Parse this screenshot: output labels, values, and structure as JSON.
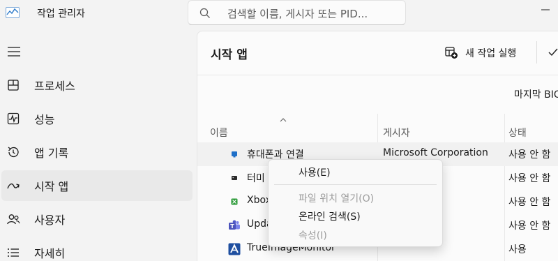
{
  "app": {
    "title": "작업 관리자"
  },
  "search": {
    "placeholder": "검색할 이름, 게시자 또는 PID..."
  },
  "sidebar": {
    "items": [
      {
        "label": "프로세스",
        "icon": "processes-icon"
      },
      {
        "label": "성능",
        "icon": "performance-icon"
      },
      {
        "label": "앱 기록",
        "icon": "app-history-icon"
      },
      {
        "label": "시작 앱",
        "icon": "startup-apps-icon",
        "active": true
      },
      {
        "label": "사용자",
        "icon": "users-icon"
      },
      {
        "label": "자세히",
        "icon": "details-icon"
      }
    ]
  },
  "main": {
    "title": "시작 앱",
    "new_task_label": "새 작업 실행",
    "last_bios_label": "마지막 BIO",
    "columns": {
      "name": "이름",
      "publisher": "게시자",
      "status": "상태"
    },
    "rows": [
      {
        "name": "휴대폰과 연결",
        "publisher": "Microsoft Corporation",
        "status": "사용 안 함",
        "icon": "phone-link-icon"
      },
      {
        "name": "터미",
        "publisher": "rporation",
        "status": "사용 안 함",
        "icon": "terminal-icon"
      },
      {
        "name": "Xbox",
        "publisher": "rporation",
        "status": "사용 안 함",
        "icon": "xbox-icon"
      },
      {
        "name": "Upda",
        "publisher": "",
        "status": "사용 안 함",
        "icon": "teams-icon"
      },
      {
        "name": "TrueImageMonitor",
        "publisher": "",
        "status": "사용",
        "icon": "acronis-icon"
      }
    ]
  },
  "context_menu": {
    "items": [
      {
        "label": "사용(E)",
        "enabled": true
      },
      {
        "label": "파일 위치 열기(O)",
        "enabled": false
      },
      {
        "label": "온라인 검색(S)",
        "enabled": true
      },
      {
        "label": "속성(I)",
        "enabled": false
      }
    ]
  },
  "colors": {
    "accent": "#0067c0",
    "sidebar_active": "#e9e9e9",
    "background": "#f3f3f3"
  }
}
